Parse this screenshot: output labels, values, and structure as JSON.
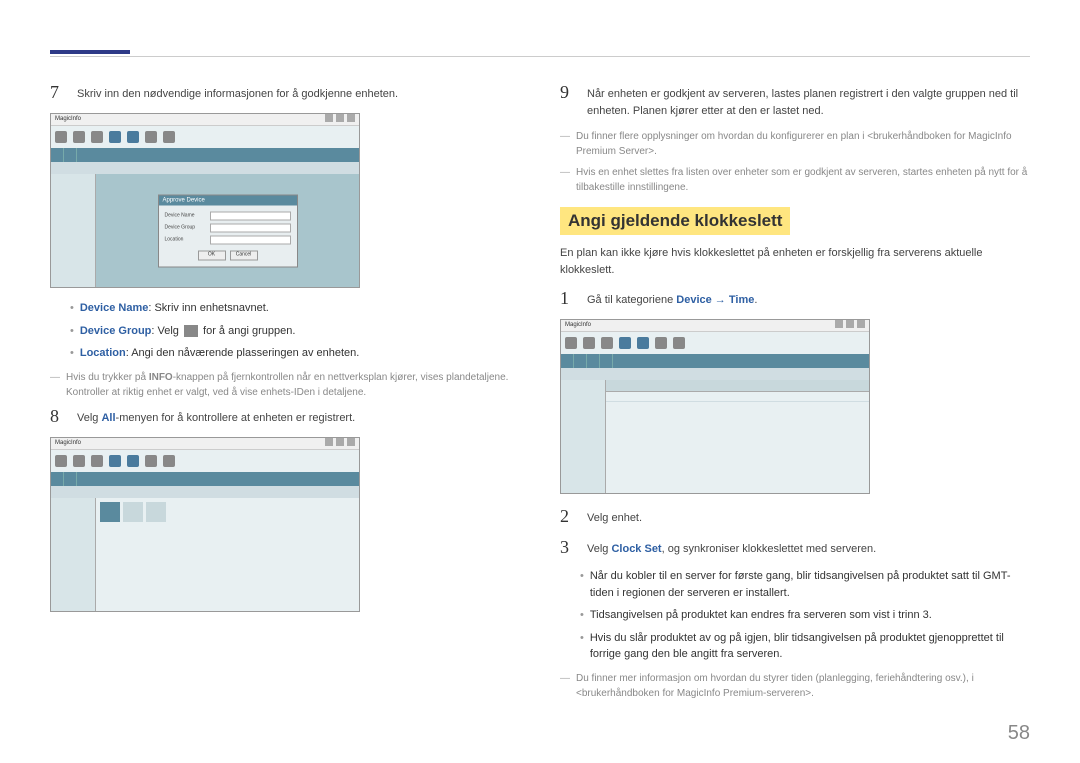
{
  "left": {
    "step7": {
      "num": "7",
      "text": "Skriv inn den nødvendige informasjonen for å godkjenne enheten."
    },
    "bullets": {
      "b1_label": "Device Name",
      "b1_text": ": Skriv inn enhetsnavnet.",
      "b2_label": "Device Group",
      "b2_text_a": ": Velg ",
      "b2_text_b": " for å angi gruppen.",
      "b3_label": "Location",
      "b3_text": ": Angi den nåværende plasseringen av enheten."
    },
    "note1_a": "Hvis du trykker på ",
    "note1_info": "INFO",
    "note1_b": "-knappen på fjernkontrollen når en nettverksplan kjører, vises plandetaljene. Kontroller at riktig enhet er valgt, ved å vise enhets-IDen i detaljene.",
    "step8": {
      "num": "8",
      "text_a": "Velg ",
      "text_all": "All",
      "text_b": "-menyen for å kontrollere at enheten er registrert."
    },
    "shot1": {
      "brand": "MagicInfo",
      "dialog_title": "Approve Device",
      "f1": "Device Name",
      "f2": "Device Group",
      "f3": "Location",
      "ok": "OK",
      "cancel": "Cancel"
    }
  },
  "right": {
    "step9": {
      "num": "9",
      "text": "Når enheten er godkjent av serveren, lastes planen registrert i den valgte gruppen ned til enheten. Planen kjører etter at den er lastet ned."
    },
    "note_a": "Du finner flere opplysninger om hvordan du konfigurerer en plan i <brukerhåndboken for MagicInfo Premium Server>.",
    "note_b": "Hvis en enhet slettes fra listen over enheter som er godkjent av serveren, startes enheten på nytt for å tilbakestille innstillingene.",
    "section": "Angi gjeldende klokkeslett",
    "intro": "En plan kan ikke kjøre hvis klokkeslettet på enheten er forskjellig fra serverens aktuelle klokkeslett.",
    "step1": {
      "num": "1",
      "text_a": "Gå til kategoriene ",
      "text_link": "Device → Time",
      "text_b": "."
    },
    "shot2": {
      "brand": "MagicInfo"
    },
    "step2": {
      "num": "2",
      "text": "Velg enhet."
    },
    "step3": {
      "num": "3",
      "text_a": "Velg ",
      "text_link": "Clock Set",
      "text_b": ", og synkroniser klokkeslettet med serveren."
    },
    "bullets2": {
      "b1": "Når du kobler til en server for første gang, blir tidsangivelsen på produktet satt til GMT-tiden i regionen der serveren er installert.",
      "b2": "Tidsangivelsen på produktet kan endres fra serveren som vist i trinn 3.",
      "b3": "Hvis du slår produktet av og på igjen, blir tidsangivelsen på produktet gjenopprettet til forrige gang den ble angitt fra serveren."
    },
    "note2": "Du finner mer informasjon om hvordan du styrer tiden (planlegging, feriehåndtering osv.), i <brukerhåndboken for MagicInfo Premium-serveren>."
  },
  "page_num": "58"
}
